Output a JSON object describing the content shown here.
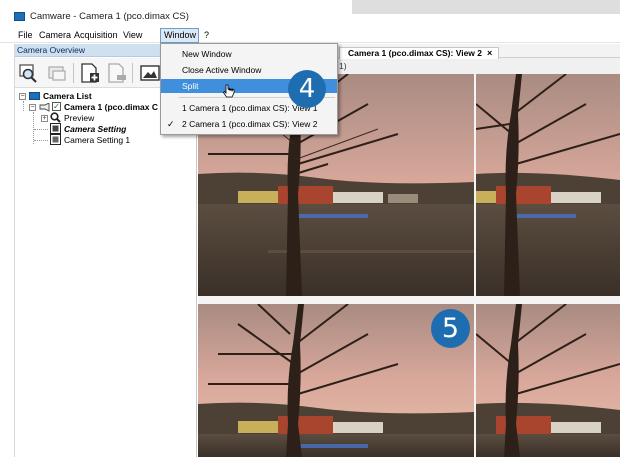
{
  "window": {
    "title": "Camware - Camera 1 (pco.dimax CS)"
  },
  "menu": {
    "items": [
      "File",
      "Camera",
      "Acquisition",
      "View",
      "Window",
      "?"
    ]
  },
  "panel": {
    "header": "Camera Overview",
    "tree": {
      "root": "Camera List",
      "camera": "Camera 1 (pco.dimax C",
      "preview": "Preview",
      "setting_active": "Camera Setting",
      "setting_1": "Camera Setting 1"
    }
  },
  "tabs": {
    "active_label": "Camera 1 (pco.dimax CS): View 2",
    "close_glyph": "×",
    "sub_label": "1)"
  },
  "window_menu": {
    "items": [
      {
        "label": "New Window"
      },
      {
        "label": "Close Active Window"
      },
      {
        "label": "Split",
        "highlighted": true
      },
      {
        "label": "1 Camera 1 (pco.dimax CS): View 1"
      },
      {
        "label": "2 Camera 1 (pco.dimax CS): View 2",
        "checked": true
      }
    ],
    "check_glyph": "✓"
  },
  "annotations": {
    "step_a": "4",
    "step_b": "5"
  },
  "colors": {
    "accent": "#1e6db0",
    "menu_highlight": "#3f8fdc",
    "panel_header": "#cfe0f1"
  },
  "icons": [
    "app-icon",
    "zoom-icon",
    "camera-icon",
    "add-icon",
    "remove-icon",
    "image-icon",
    "checkbox-icon",
    "camera-tree-icon",
    "magnifier-icon",
    "setting-icon",
    "cursor-icon"
  ]
}
